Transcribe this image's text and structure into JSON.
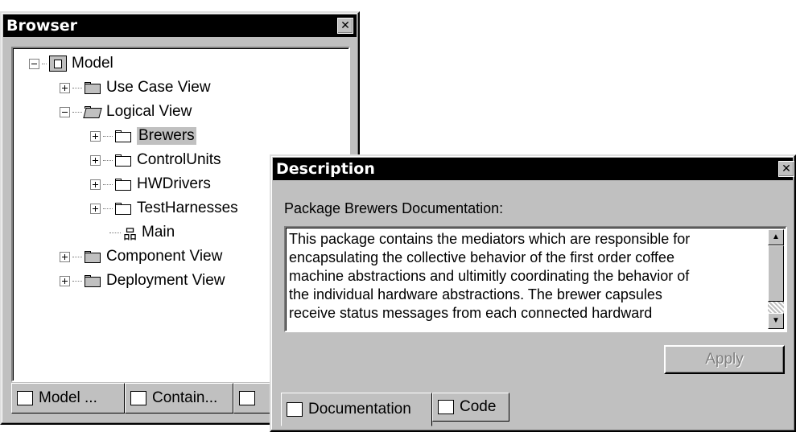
{
  "browser": {
    "title": "Browser",
    "close_glyph": "✕",
    "tree": [
      {
        "label": "Model",
        "icon": "model-icon",
        "toggle": "minus"
      },
      {
        "label": "Use Case View",
        "icon": "folder-icon",
        "toggle": "plus"
      },
      {
        "label": "Logical View",
        "icon": "folder-open-icon",
        "toggle": "minus"
      },
      {
        "label": "Brewers",
        "icon": "package-icon",
        "toggle": "plus",
        "selected": true
      },
      {
        "label": "ControlUnits",
        "icon": "package-icon",
        "toggle": "plus"
      },
      {
        "label": "HWDrivers",
        "icon": "package-icon",
        "toggle": "plus"
      },
      {
        "label": "TestHarnesses",
        "icon": "package-icon",
        "toggle": "plus"
      },
      {
        "label": "Main",
        "icon": "class-diagram-icon",
        "toggle": "none"
      },
      {
        "label": "Component View",
        "icon": "folder-icon",
        "toggle": "plus"
      },
      {
        "label": "Deployment View",
        "icon": "folder-icon",
        "toggle": "plus"
      }
    ],
    "tabs": [
      {
        "label": "Model ...",
        "icon": "model-tab-icon"
      },
      {
        "label": "Contain...",
        "icon": "container-tab-icon"
      }
    ]
  },
  "description": {
    "title": "Description",
    "close_glyph": "✕",
    "heading": "Package Brewers Documentation:",
    "lines": [
      "This package contains the mediators which are responsible for",
      "encapsulating the collective behavior of the first order coffee",
      "machine abstractions and ultimitly coordinating the behavior of",
      "the individual hardware abstractions. The brewer capsules",
      "receive status messages from each connected hardward"
    ],
    "apply_label": "Apply",
    "tabs": [
      {
        "label": "Documentation",
        "icon": "documentation-icon"
      },
      {
        "label": "Code",
        "icon": "code-icon"
      }
    ],
    "scroll_up": "▲",
    "scroll_down": "▼"
  }
}
